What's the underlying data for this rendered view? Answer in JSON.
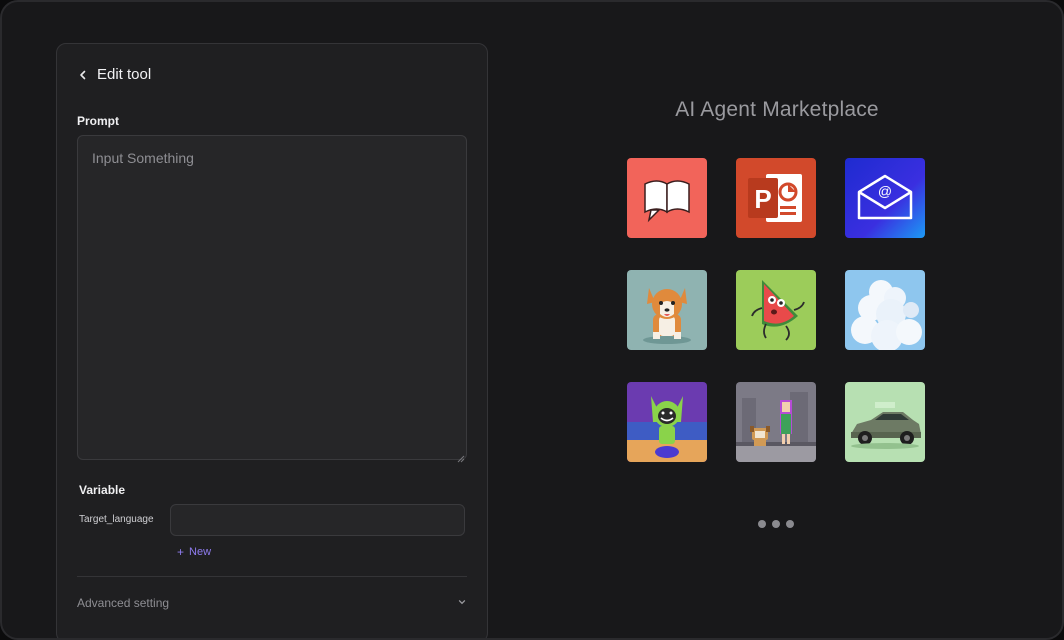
{
  "panel": {
    "title": "Edit tool",
    "prompt_label": "Prompt",
    "prompt_placeholder": "Input Something",
    "prompt_value": "",
    "variable_label": "Variable",
    "variables": [
      {
        "name": "Target_language",
        "value": ""
      }
    ],
    "add_new_label": "New",
    "advanced_label": "Advanced setting"
  },
  "marketplace": {
    "title": "AI Agent Marketplace",
    "tiles": [
      {
        "icon": "chat-book-icon",
        "bg": "#f2645a"
      },
      {
        "icon": "powerpoint-icon",
        "bg": "#d2492b"
      },
      {
        "icon": "email-icon",
        "bg": "#2c2fd8"
      },
      {
        "icon": "corgi-icon",
        "bg": "#7fa7a6"
      },
      {
        "icon": "watermelon-icon",
        "bg": "#9ccc5a"
      },
      {
        "icon": "clouds-icon",
        "bg": "#8ec6ee"
      },
      {
        "icon": "cat-hood-icon",
        "bg": "#6b3bb0"
      },
      {
        "icon": "girl-dog-icon",
        "bg": "#7c7a86"
      },
      {
        "icon": "car-icon",
        "bg": "#b7e0b2"
      }
    ],
    "pager_count": 3
  },
  "colors": {
    "accent": "#8f7cf0",
    "background": "#18181a",
    "panel": "#1f1f21"
  }
}
